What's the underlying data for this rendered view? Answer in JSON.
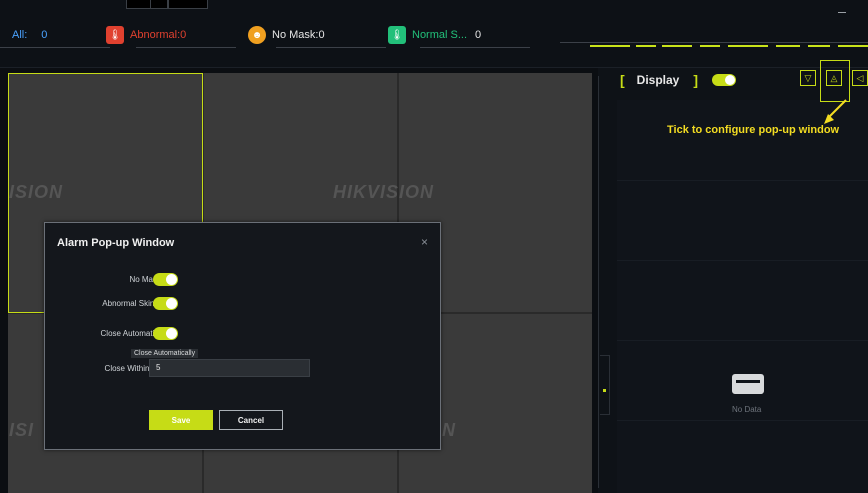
{
  "topbar": {
    "all_label": "All:",
    "all_count": "0",
    "abnormal_label": "Abnormal:0",
    "no_mask_label": "No Mask:0",
    "normal_label": "Normal S...",
    "normal_count": "0",
    "minimize_symbol": "−"
  },
  "watermarks": {
    "top_left": "ISION",
    "top_mid": "HIKVISION",
    "bottom_left": "ISI",
    "bottom_mid": "N"
  },
  "right_panel": {
    "display_label": "Display",
    "display_toggle_on": true,
    "tip_text": "Tick to configure pop-up window",
    "no_data_label": "No Data",
    "icons": [
      "filter-icon",
      "bell-icon",
      "speaker-icon"
    ]
  },
  "dialog": {
    "title": "Alarm Pop-up Window",
    "close_symbol": "×",
    "rows": [
      {
        "label": "No Mask",
        "on": true
      },
      {
        "label": "Abnormal Skin...",
        "on": true
      },
      {
        "label": "Close Automati...",
        "on": true
      }
    ],
    "tooltip": "Close Automatically",
    "close_within_label": "Close Within (s)",
    "close_within_value": "5",
    "save_label": "Save",
    "cancel_label": "Cancel"
  },
  "colors": {
    "accent": "#c6dc16",
    "tip": "#f3dc22",
    "abnormal": "#e0412f",
    "no_mask": "#f0a020",
    "normal": "#22c07a"
  }
}
